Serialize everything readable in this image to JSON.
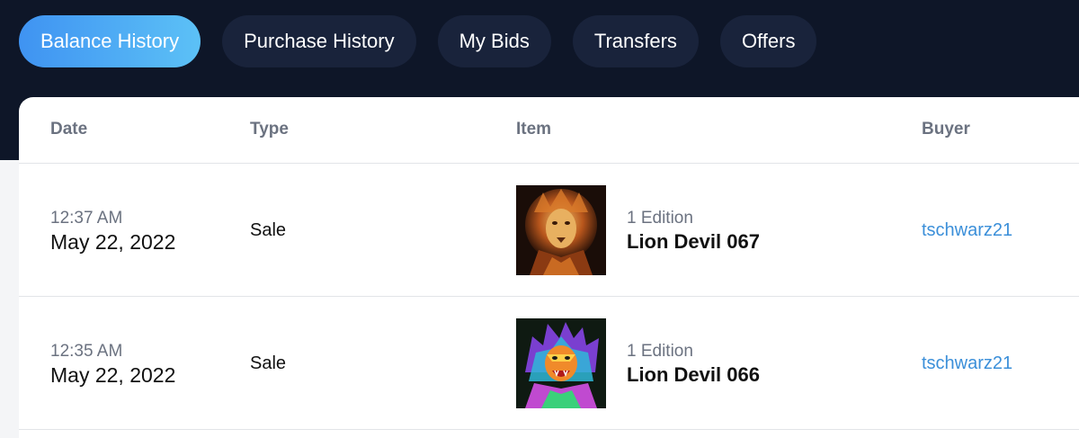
{
  "tabs": [
    {
      "label": "Balance History",
      "active": true
    },
    {
      "label": "Purchase History",
      "active": false
    },
    {
      "label": "My Bids",
      "active": false
    },
    {
      "label": "Transfers",
      "active": false
    },
    {
      "label": "Offers",
      "active": false
    }
  ],
  "table": {
    "headers": {
      "date": "Date",
      "type": "Type",
      "item": "Item",
      "buyer": "Buyer"
    },
    "rows": [
      {
        "time": "12:37 AM",
        "date": "May 22, 2022",
        "type": "Sale",
        "edition": "1 Edition",
        "item_name": "Lion Devil 067",
        "buyer": "tschwarz21",
        "thumbnail_icon": "lion-artwork-golden"
      },
      {
        "time": "12:35 AM",
        "date": "May 22, 2022",
        "type": "Sale",
        "edition": "1 Edition",
        "item_name": "Lion Devil 066",
        "buyer": "tschwarz21",
        "thumbnail_icon": "lion-artwork-neon"
      }
    ]
  },
  "colors": {
    "header_bg": "#0e1628",
    "tab_bg": "#19233b",
    "active_tab_gradient_start": "#3f93f2",
    "active_tab_gradient_end": "#5cc1f6",
    "link": "#3b8fd9"
  }
}
